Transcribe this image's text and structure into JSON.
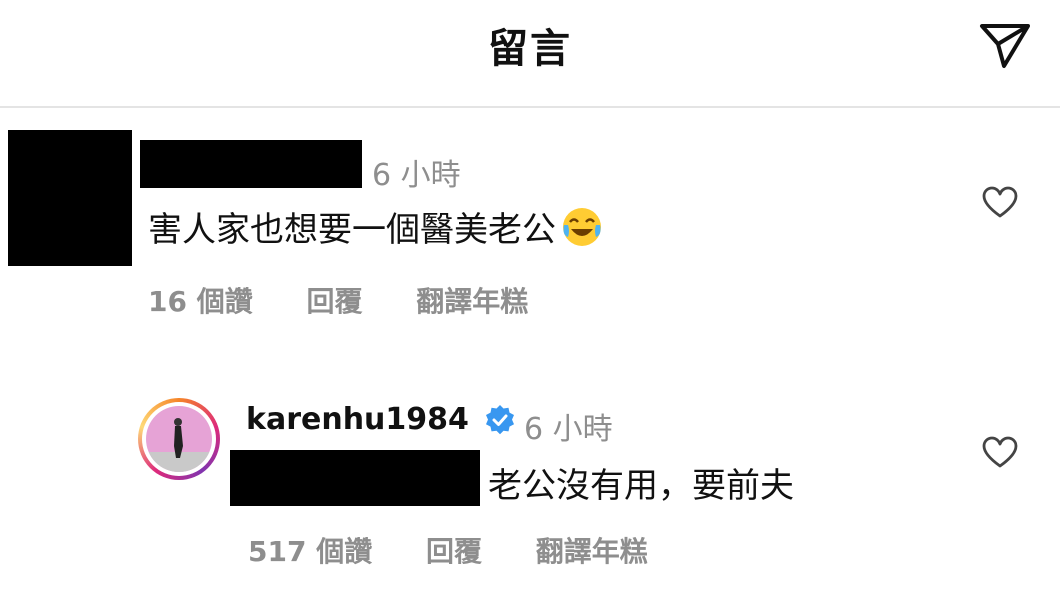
{
  "header": {
    "title": "留言",
    "send_icon": "paper-plane-icon"
  },
  "comments": [
    {
      "time": "6 小時",
      "text": "害人家也想要一個醫美老公",
      "emoji": "joy-emoji",
      "likes": "16 個讚",
      "reply": "回覆",
      "translate": "翻譯年糕"
    },
    {
      "username": "karenhu1984",
      "time": "6 小時",
      "text": "老公沒有用，要前夫",
      "likes": "517 個讚",
      "reply": "回覆",
      "translate": "翻譯年糕"
    }
  ],
  "colors": {
    "verified": "#3897f0",
    "muted": "#8e8e8e",
    "divider": "#e4e4e4"
  }
}
